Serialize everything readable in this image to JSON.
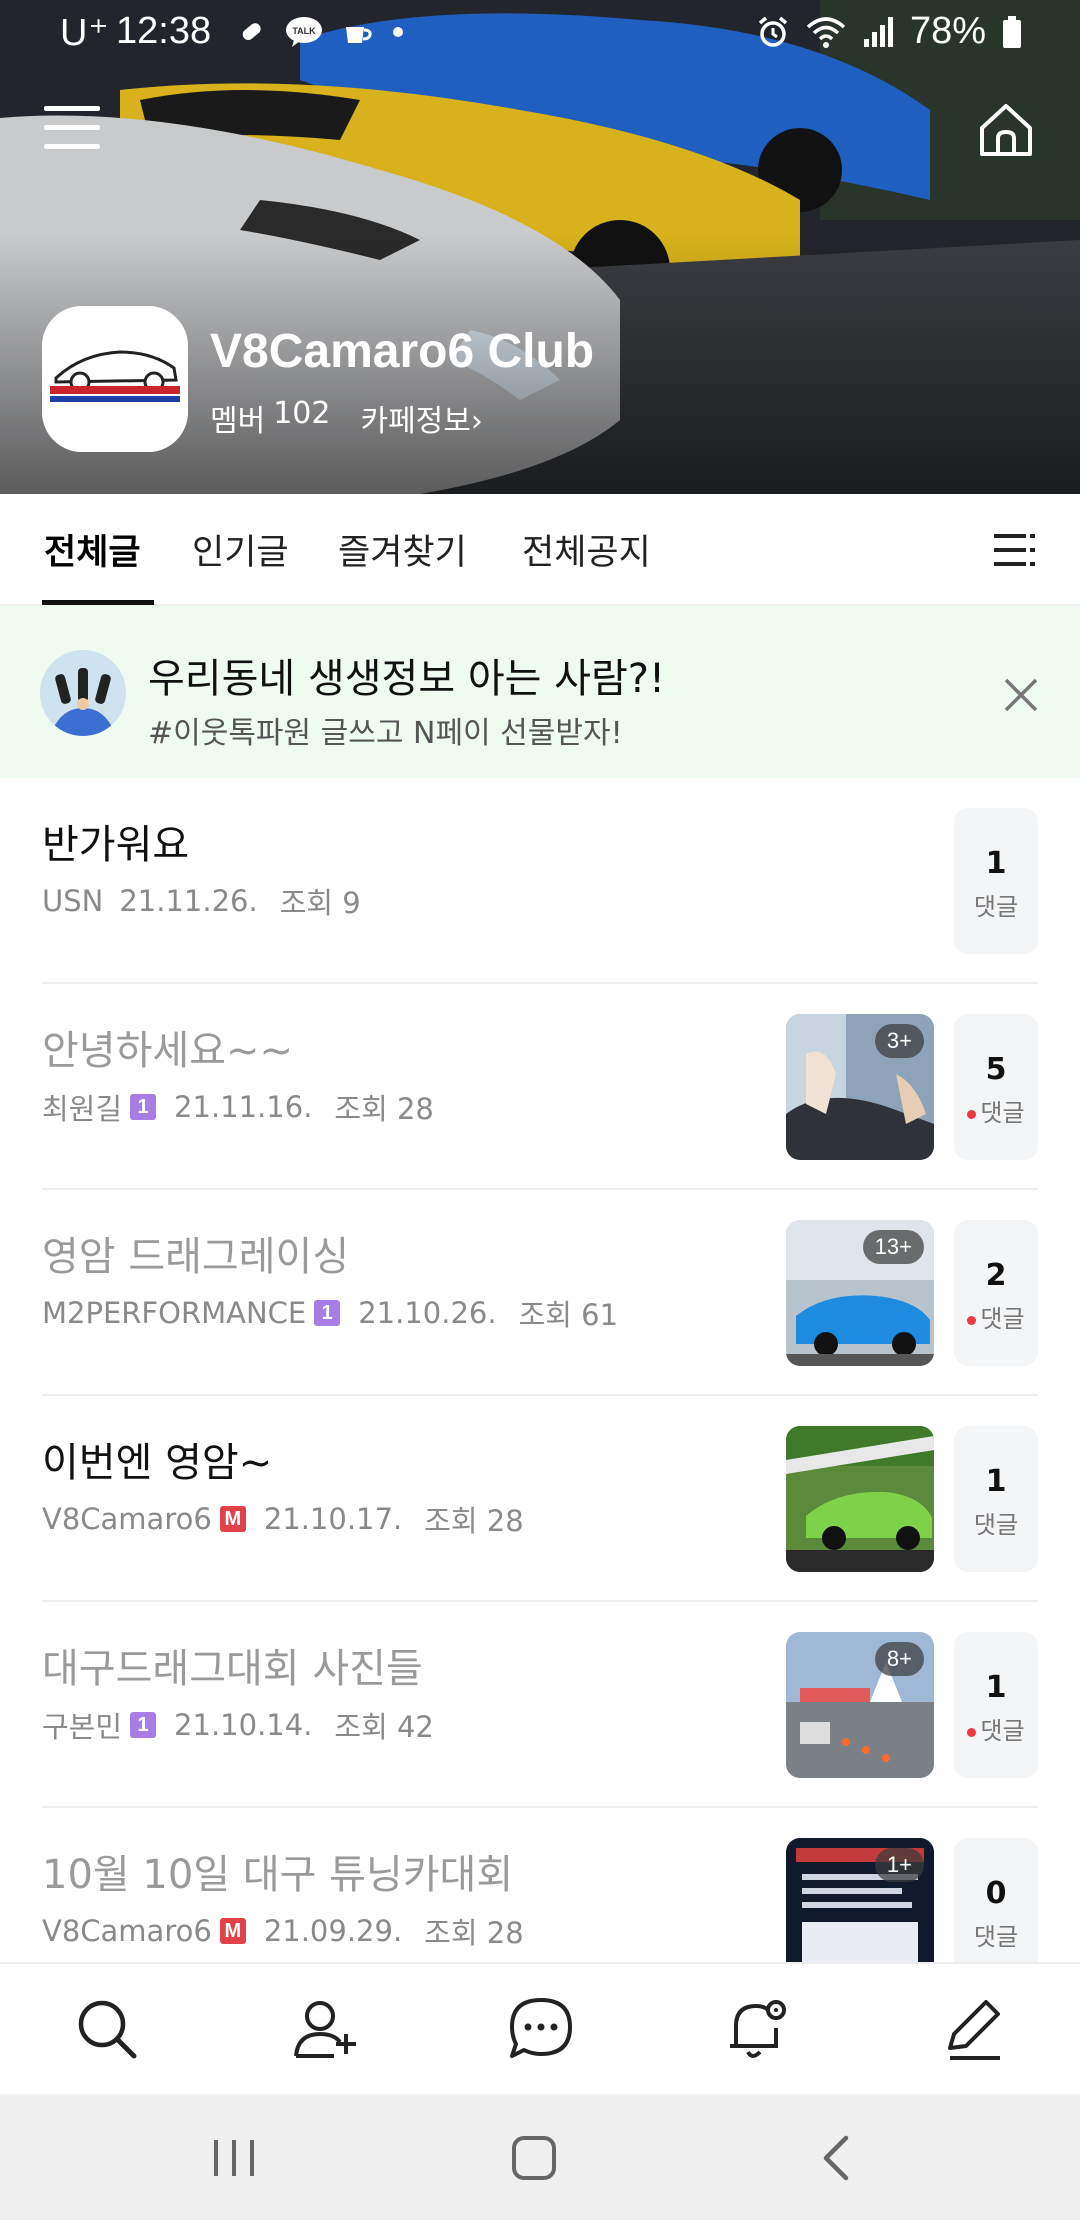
{
  "status_bar": {
    "carrier": "U⁺",
    "time": "12:38",
    "battery": "78%"
  },
  "cafe": {
    "name": "V8Camaro6 Club",
    "member_label": "멤버",
    "member_count": "102",
    "info_link": "카페정보",
    "info_chevron": "›"
  },
  "tabs": [
    {
      "label": "전체글",
      "active": true
    },
    {
      "label": "인기글",
      "active": false
    },
    {
      "label": "즐겨찾기",
      "active": false
    },
    {
      "label": "전체공지",
      "active": false
    }
  ],
  "banner": {
    "title": "우리동네 생생정보 아는 사람?!",
    "subtitle": "#이웃톡파원 글쓰고 N페이 선물받자!"
  },
  "posts": [
    {
      "title": "반가워요",
      "author": "USN",
      "badge": "",
      "date": "21.11.26.",
      "views": "조회 9",
      "thumb_count": "",
      "comments": "1",
      "comment_label": "댓글",
      "new_comment": false,
      "read": false
    },
    {
      "title": "안녕하세요~~",
      "author": "최원길",
      "badge": "1",
      "date": "21.11.16.",
      "views": "조회 28",
      "thumb_count": "3+",
      "comments": "5",
      "comment_label": "댓글",
      "new_comment": true,
      "read": true
    },
    {
      "title": "영암 드래그레이싱",
      "author": "M2PERFORMANCE",
      "badge": "1",
      "date": "21.10.26.",
      "views": "조회 61",
      "thumb_count": "13+",
      "comments": "2",
      "comment_label": "댓글",
      "new_comment": true,
      "read": true
    },
    {
      "title": "이번엔 영암~",
      "author": "V8Camaro6",
      "badge": "M",
      "date": "21.10.17.",
      "views": "조회 28",
      "thumb_count": "",
      "comments": "1",
      "comment_label": "댓글",
      "new_comment": false,
      "read": false
    },
    {
      "title": "대구드래그대회 사진들",
      "author": "구본민",
      "badge": "1",
      "date": "21.10.14.",
      "views": "조회 42",
      "thumb_count": "8+",
      "comments": "1",
      "comment_label": "댓글",
      "new_comment": true,
      "read": true
    },
    {
      "title": "10월 10일 대구 튜닝카대회",
      "author": "V8Camaro6",
      "badge": "M",
      "date": "21.09.29.",
      "views": "조회 28",
      "thumb_count": "1+",
      "comments": "0",
      "comment_label": "댓글",
      "new_comment": false,
      "read": true
    }
  ],
  "icons": {
    "menu": "hamburger-menu-icon",
    "home": "home-icon",
    "tab_list": "list-menu-icon",
    "banner_close": "close-icon",
    "bottom": [
      "search-icon",
      "add-member-icon",
      "chat-icon",
      "notification-settings-icon",
      "write-icon"
    ],
    "nav": [
      "recent-apps-icon",
      "home-button-icon",
      "back-icon"
    ]
  },
  "colors": {
    "banner_bg": "#effaf1",
    "level_badge": "#a77de6",
    "manager_badge": "#e0424a",
    "new_comment_dot": "#f0383d"
  }
}
